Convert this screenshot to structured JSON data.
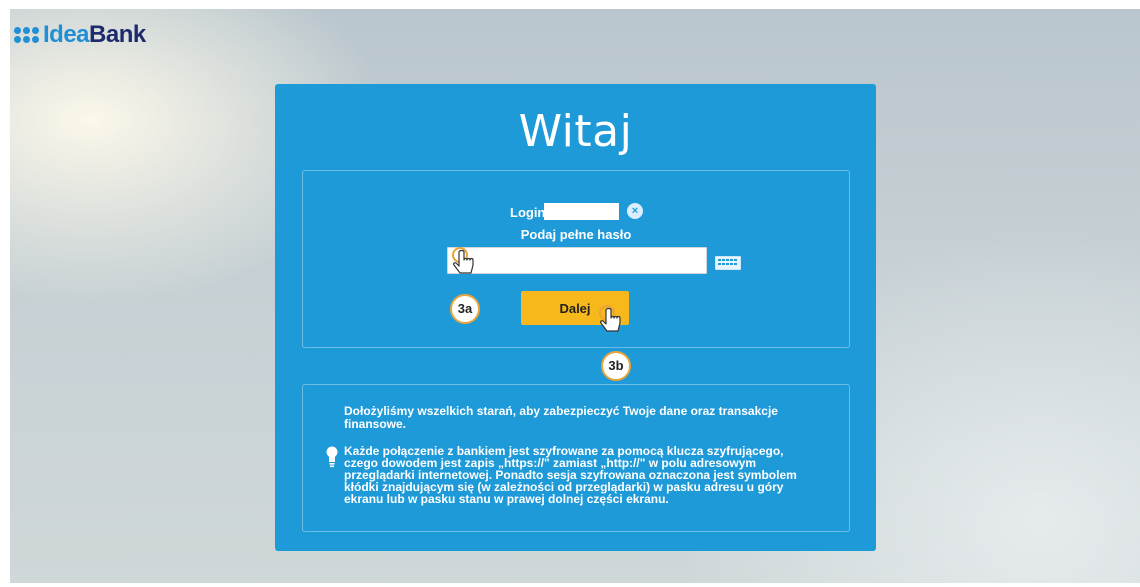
{
  "logo": {
    "part1": "Idea",
    "part2": "Bank"
  },
  "panel": {
    "title": "Witaj",
    "login_label": "Login:",
    "login_value": "",
    "clear_icon": "×",
    "password_label": "Podaj pełne hasło",
    "password_value": "",
    "submit_label": "Dalej"
  },
  "info": {
    "heading": "Dołożyliśmy wszelkich starań, aby zabezpieczyć Twoje dane oraz transakcje finansowe.",
    "body": "Każde połączenie z bankiem jest szyfrowane za pomocą klucza szyfrującego, czego dowodem jest zapis „https://\" zamiast „http://\" w polu adresowym przeglądarki internetowej. Ponadto sesja szyfrowana oznaczona jest symbolem kłódki znajdującym się (w zależności od przeglądarki) w pasku adresu u góry ekranu lub w pasku stanu w prawej dolnej części ekranu."
  },
  "markers": {
    "a": "3a",
    "b": "3b"
  },
  "colors": {
    "panel": "#1e9ad9",
    "button": "#f6b81a",
    "logo_blue": "#1f8fd6",
    "logo_navy": "#1e2a6e",
    "marker_ring": "#e8a43a"
  },
  "icons": [
    "logo-dots-icon",
    "clear-icon",
    "virtual-keyboard-icon",
    "lightbulb-icon",
    "hand-pointer-icon"
  ]
}
